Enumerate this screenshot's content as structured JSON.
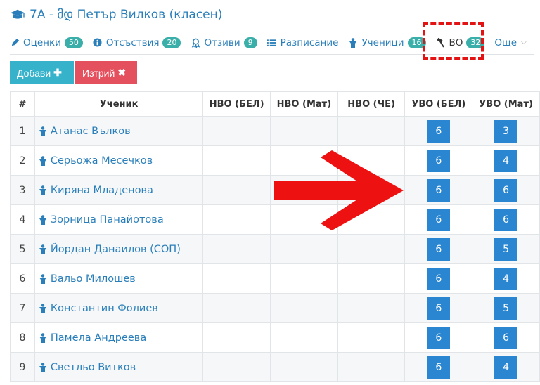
{
  "header": {
    "title": "7А - მდ Петър Вилков (класен)"
  },
  "tabs": [
    {
      "label": "Оценки",
      "badge": "50",
      "icon": "pencil-icon"
    },
    {
      "label": "Отсъствия",
      "badge": "20",
      "icon": "info-icon"
    },
    {
      "label": "Отзиви",
      "badge": "9",
      "icon": "award-icon"
    },
    {
      "label": "Разписание",
      "badge": "",
      "icon": "list-icon"
    },
    {
      "label": "Ученици",
      "badge": "16",
      "icon": "student-icon"
    },
    {
      "label": "ВО",
      "badge": "32",
      "icon": "hammer-icon"
    },
    {
      "label": "Още",
      "badge": "",
      "icon": "chevron-down-icon"
    }
  ],
  "toolbar": {
    "add_label": "Добави",
    "delete_label": "Изтрий"
  },
  "table": {
    "headers": [
      "#",
      "Ученик",
      "НВО (БЕЛ)",
      "НВО (Мат)",
      "НВО (ЧЕ)",
      "УВО (БЕЛ)",
      "УВО (Мат)"
    ],
    "rows": [
      {
        "num": "1",
        "name": "Атанас Вълков",
        "uvo_bel": "6",
        "uvo_mat": "3"
      },
      {
        "num": "2",
        "name": "Серьожа Месечков",
        "uvo_bel": "6",
        "uvo_mat": "4"
      },
      {
        "num": "3",
        "name": "Киряна Младенова",
        "uvo_bel": "6",
        "uvo_mat": "6"
      },
      {
        "num": "4",
        "name": "Зорница Панайотова",
        "uvo_bel": "6",
        "uvo_mat": "6"
      },
      {
        "num": "5",
        "name": "Йордан Данаилов (СОП)",
        "uvo_bel": "6",
        "uvo_mat": "5"
      },
      {
        "num": "6",
        "name": "Вальо Милошев",
        "uvo_bel": "6",
        "uvo_mat": "4"
      },
      {
        "num": "7",
        "name": "Константин Фолиев",
        "uvo_bel": "6",
        "uvo_mat": "5"
      },
      {
        "num": "8",
        "name": "Памела Андреева",
        "uvo_bel": "6",
        "uvo_mat": "6"
      },
      {
        "num": "9",
        "name": "Светльо Витков",
        "uvo_bel": "6",
        "uvo_mat": "4"
      }
    ]
  },
  "colors": {
    "link": "#2a7fba",
    "badge": "#3aafa9",
    "add": "#37b2cb",
    "delete": "#e4505e",
    "grade": "#2a86d1",
    "annotation": "#e41313"
  }
}
